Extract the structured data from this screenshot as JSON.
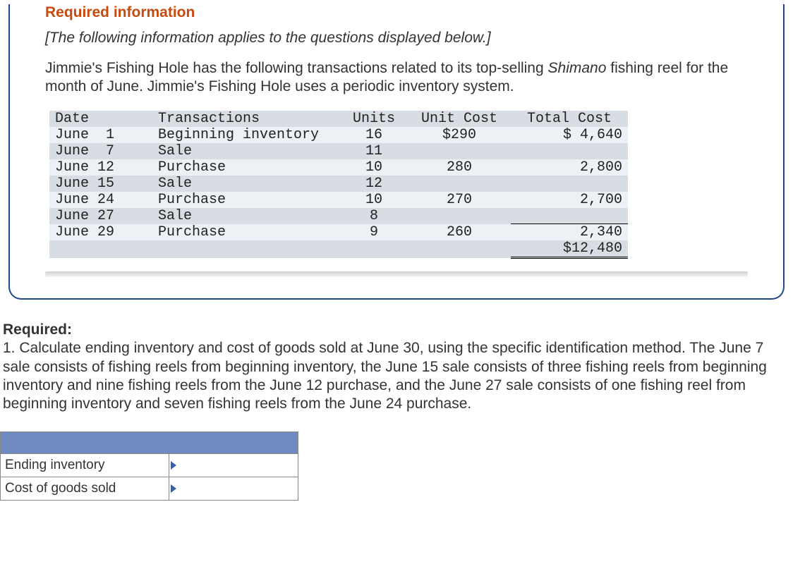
{
  "req_info_title": "Required information",
  "italic_note": "[The following information applies to the questions displayed below.]",
  "problem_text_1": "Jimmie's Fishing Hole has the following transactions related to its top-selling ",
  "problem_text_brand": "Shimano",
  "problem_text_2": " fishing reel for the month of June. Jimmie's Fishing Hole uses a periodic inventory system.",
  "headers": {
    "date": "Date",
    "tx": "Transactions",
    "units": "Units",
    "unit_cost": "Unit Cost",
    "total_cost": "Total Cost"
  },
  "rows": [
    {
      "date": "June  1",
      "tx": "Beginning inventory",
      "units": "16",
      "unit_cost": "$290",
      "total_cost": "$ 4,640"
    },
    {
      "date": "June  7",
      "tx": "Sale",
      "units": "11",
      "unit_cost": "",
      "total_cost": ""
    },
    {
      "date": "June 12",
      "tx": "Purchase",
      "units": "10",
      "unit_cost": "280",
      "total_cost": "2,800"
    },
    {
      "date": "June 15",
      "tx": "Sale",
      "units": "12",
      "unit_cost": "",
      "total_cost": ""
    },
    {
      "date": "June 24",
      "tx": "Purchase",
      "units": "10",
      "unit_cost": "270",
      "total_cost": "2,700"
    },
    {
      "date": "June 27",
      "tx": "Sale",
      "units": "8",
      "unit_cost": "",
      "total_cost": ""
    },
    {
      "date": "June 29",
      "tx": "Purchase",
      "units": "9",
      "unit_cost": "260",
      "total_cost": "2,340"
    }
  ],
  "total": "$12,480",
  "required_label": "Required:",
  "required_item": "1. Calculate ending inventory and cost of goods sold at June 30, using the specific identification method. The June 7 sale consists of fishing reels from beginning inventory, the June 15 sale consists of three fishing reels from beginning inventory and nine fishing reels from the June 12 purchase, and the June 27 sale consists of one fishing reel from beginning inventory and seven fishing reels from the June 24 purchase.",
  "answers": {
    "ending_inventory_label": "Ending inventory",
    "cogs_label": "Cost of goods sold"
  },
  "chart_data": {
    "type": "table",
    "title": "Inventory transactions — June",
    "columns": [
      "Date",
      "Transactions",
      "Units",
      "Unit Cost",
      "Total Cost"
    ],
    "rows": [
      [
        "June 1",
        "Beginning inventory",
        16,
        290,
        4640
      ],
      [
        "June 7",
        "Sale",
        11,
        null,
        null
      ],
      [
        "June 12",
        "Purchase",
        10,
        280,
        2800
      ],
      [
        "June 15",
        "Sale",
        12,
        null,
        null
      ],
      [
        "June 24",
        "Purchase",
        10,
        270,
        2700
      ],
      [
        "June 27",
        "Sale",
        8,
        null,
        null
      ],
      [
        "June 29",
        "Purchase",
        9,
        260,
        2340
      ]
    ],
    "total_cost": 12480
  }
}
